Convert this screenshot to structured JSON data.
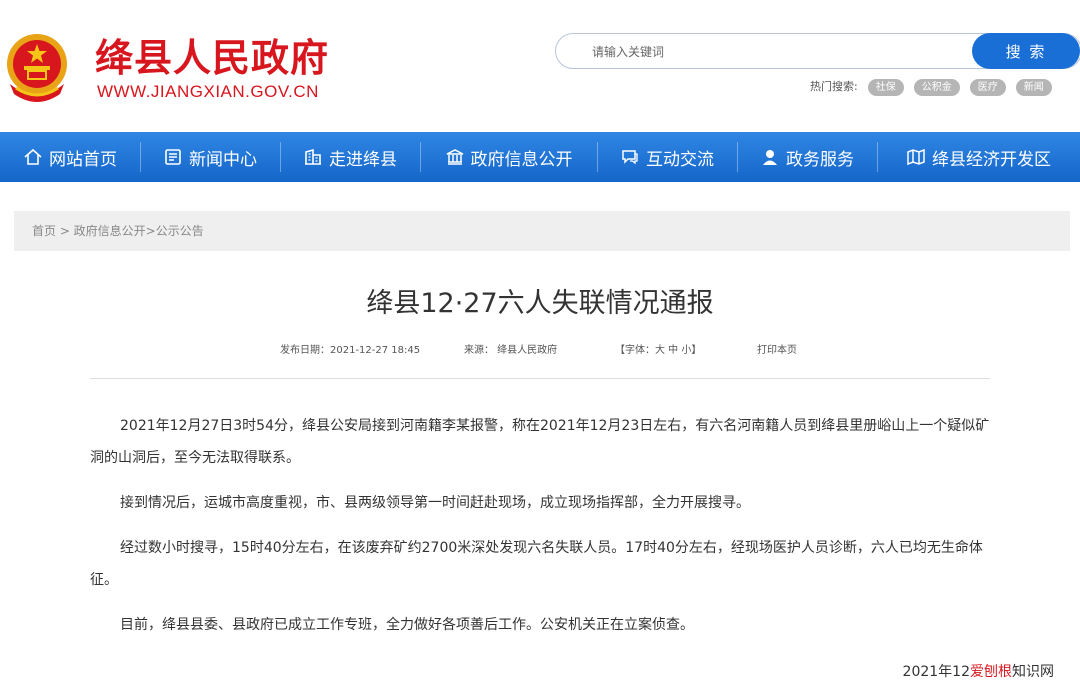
{
  "header": {
    "site_name": "绛县人民政府",
    "site_url": "WWW.JIANGXIAN.GOV.CN",
    "search_placeholder": "请输入关键词",
    "search_button": "搜 索",
    "hot_label": "热门搜索:",
    "hot_tags": [
      "社保",
      "公积金",
      "医疗",
      "新闻"
    ]
  },
  "nav": {
    "items": [
      {
        "label": "网站首页",
        "icon": "home-icon"
      },
      {
        "label": "新闻中心",
        "icon": "news-icon"
      },
      {
        "label": "走进绛县",
        "icon": "building-icon"
      },
      {
        "label": "政府信息公开",
        "icon": "government-icon"
      },
      {
        "label": "互动交流",
        "icon": "chat-icon"
      },
      {
        "label": "政务服务",
        "icon": "user-service-icon"
      },
      {
        "label": "绛县经济开发区",
        "icon": "map-icon"
      }
    ]
  },
  "breadcrumb": "首页 > 政府信息公开>公示公告",
  "article": {
    "title": "绛县12·27六人失联情况通报",
    "publish_date": "发布日期：2021-12-27 18:45",
    "source": "来源：  绛县人民政府",
    "font_size": "【字体：大 中 小】",
    "print": "打印本页",
    "paragraphs": [
      "2021年12月27日3时54分，绛县公安局接到河南籍李某报警，称在2021年12月23日左右，有六名河南籍人员到绛县里册峪山上一个疑似矿洞的山洞后，至今无法取得联系。",
      "接到情况后，运城市高度重视，市、县两级领导第一时间赶赴现场，成立现场指挥部，全力开展搜寻。",
      "经过数小时搜寻，15时40分左右，在该废弃矿约2700米深处发现六名失联人员。17时40分左右，经现场医护人员诊断，六人已均无生命体征。",
      "目前，绛县县委、县政府已成立工作专班，全力做好各项善后工作。公安机关正在立案侦查。"
    ],
    "footer_prefix": "2021年12",
    "footer_watermark": "爱刨根",
    "footer_suffix": "知识网"
  },
  "colors": {
    "brand_red": "#d7161e",
    "nav_blue": "#1a6fd6"
  }
}
